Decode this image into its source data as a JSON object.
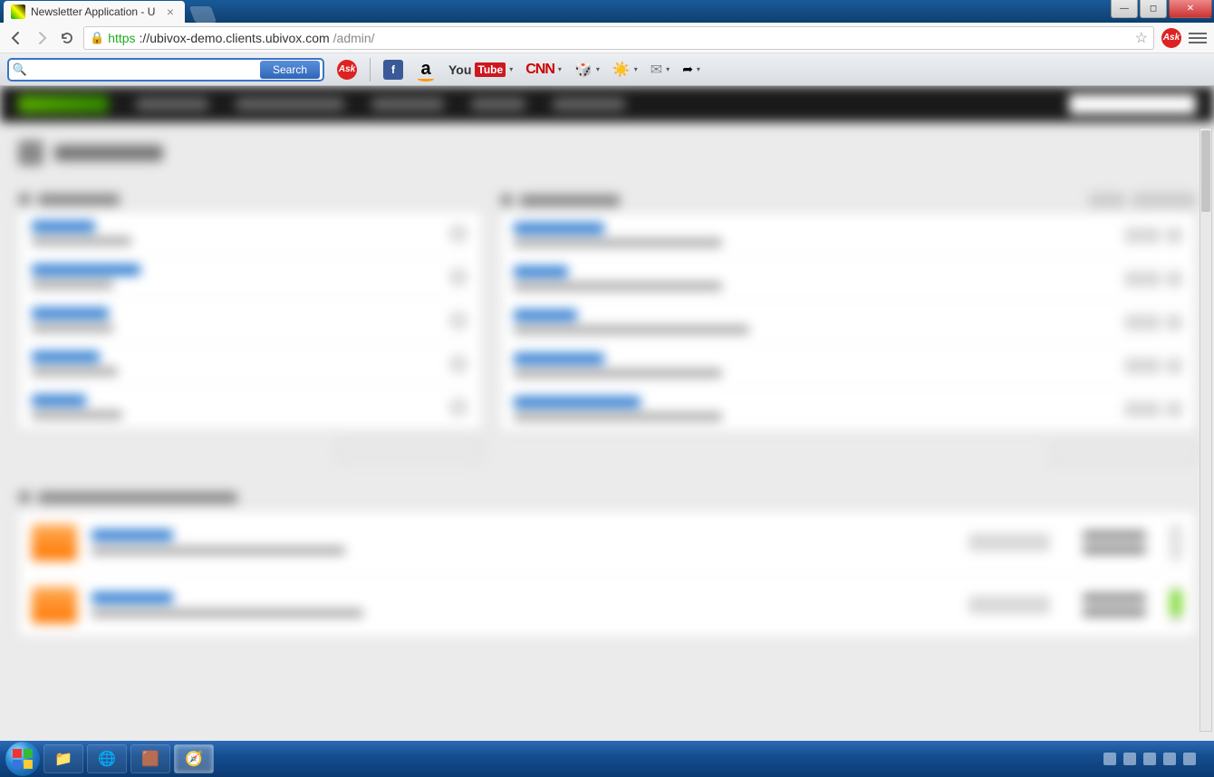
{
  "window": {
    "min_glyph": "—",
    "max_glyph": "◻",
    "close_glyph": "✕"
  },
  "browser": {
    "tab_title": "Newsletter Application - U",
    "url_https": "https",
    "url_host": "://ubivox-demo.clients.ubivox.com",
    "url_path": "/admin/",
    "lock_glyph": "🔒",
    "star_glyph": "☆",
    "ask_label": "Ask"
  },
  "toolbar": {
    "search_placeholder": "",
    "search_btn": "Search",
    "ask_label": "Ask",
    "facebook": "f",
    "amazon": "a",
    "youtube_a": "You",
    "youtube_b": "Tube",
    "cnn": "CNN",
    "dice": "🎲",
    "weather": "☀️",
    "mail": "✉",
    "share": "➦",
    "drop": "▾"
  },
  "page": {
    "title": "Dashboard"
  },
  "taskbar": {
    "items": [
      "📁",
      "🌐",
      "🟫",
      "🧭"
    ],
    "time": "",
    "date": ""
  }
}
